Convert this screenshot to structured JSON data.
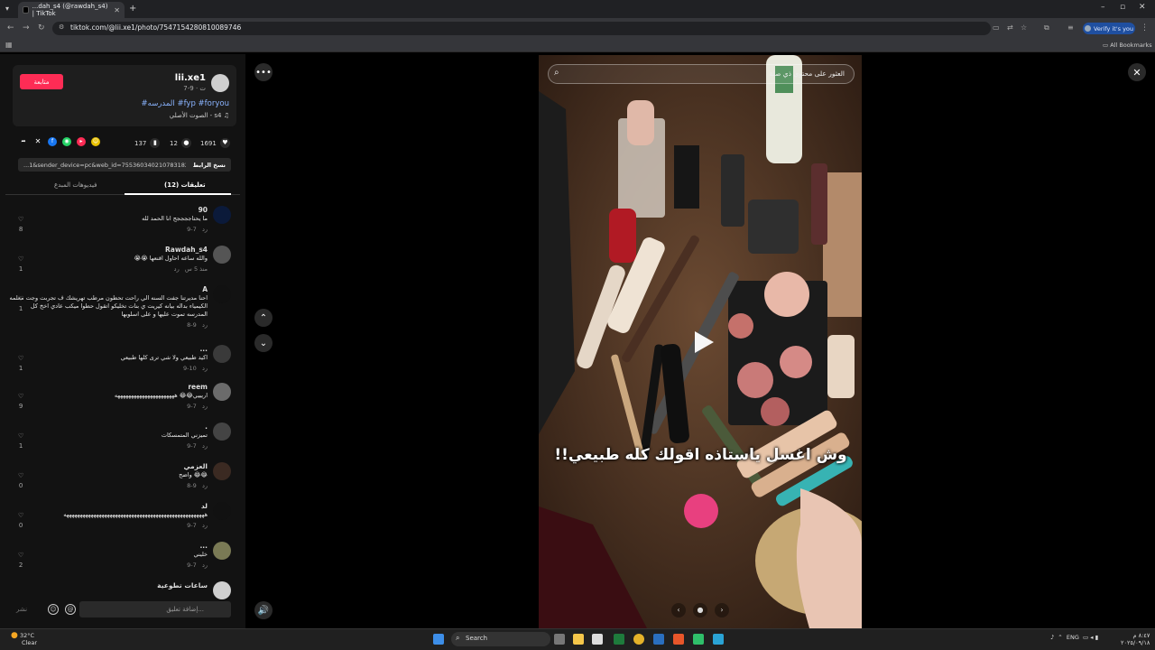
{
  "browser": {
    "tab_title": "...dah_s4 (@rawdah_s4) | TikTok",
    "url": "tiktok.com/@lii.xe1/photo/7547154280810089746",
    "verify_label": "Verify it's you",
    "bookmarks_label": "All Bookmarks"
  },
  "author": {
    "username": "lii.xe1",
    "date": "ت · 9-7",
    "follow_label": "متابعة",
    "hashtags": "#المدرسه #fyp #foryou",
    "sound": "الصوت الأصلي - s4"
  },
  "stats": {
    "likes": "1691",
    "comments": "12",
    "saves": "137"
  },
  "link": {
    "copy_label": "نسخ الرابط",
    "url_text": "...1&sender_device=pc&web_id=7553603402107831829"
  },
  "tabs": {
    "comments": "تعليقات (12)",
    "creator_videos": "فيديوهات المبدع"
  },
  "comments": [
    {
      "name": "90",
      "text": "ما يحتاججججج انا الحمد لله",
      "date": "9-7",
      "reply": "رد",
      "likes": "8",
      "avatar_color": "#0b1a3a"
    },
    {
      "name": "Rawdah_s4",
      "text": "والله ساعه احاول اقنعها 😭😭",
      "date": "منذ 5 س",
      "reply": "رد",
      "likes": "1",
      "avatar_color": "#555"
    },
    {
      "name": "A",
      "text": "احنا مديرتنا جفت السنه الي راحت تحطون مرطب تهريشك ف تجربت وجت معلمه الكيمياء بداله بيانه كيريت ي بنات تخليكو اتقول حطوا ميكب عادي اخخ كل المدرسه تموت عليها و على اسلوبها",
      "date": "8-9",
      "reply": "رد",
      "likes": "1",
      "avatar_color": "#111"
    },
    {
      "name": "...",
      "text": "اكيد طبيعي ولا شي ترى كلها طبيعي",
      "date": "9-10",
      "reply": "رد",
      "likes": "1",
      "avatar_color": "#3a3a3a"
    },
    {
      "name": "reem",
      "text": "اريييي😂😂 ههههههههههههههههههههههه",
      "date": "9-7",
      "reply": "رد",
      "likes": "9",
      "avatar_color": "#6b6b6b"
    },
    {
      "name": ".",
      "text": "تميزني المتمسكات",
      "date": "9-7",
      "reply": "رد",
      "likes": "1",
      "avatar_color": "#444"
    },
    {
      "name": "العزمي",
      "text": "😂😂 واضح",
      "date": "8-9",
      "reply": "رد",
      "likes": "0",
      "avatar_color": "#3b2a22"
    },
    {
      "name": "لد",
      "text": "ههههههههههههههههههههههههههههههههههههههههههههههههههههه",
      "date": "9-7",
      "reply": "رد",
      "likes": "0",
      "avatar_color": "#111"
    },
    {
      "name": "...",
      "text": "خليني",
      "date": "9-7",
      "reply": "رد",
      "likes": "2",
      "avatar_color": "#7a7a55"
    },
    {
      "name": "ساعات تطوعية",
      "text": "",
      "date": "",
      "reply": "",
      "likes": "",
      "avatar_color": "#cfcfcf"
    }
  ],
  "composer": {
    "placeholder": "إضافة تعليق...",
    "post_label": "نشر"
  },
  "viewer": {
    "search_placeholder": "العثور على محتوى ذي صلة",
    "caption": "وش اغسل ياستاذه اقولك كله طبيعي!!"
  },
  "taskbar": {
    "temp": "32°C",
    "condition": "Clear",
    "search_label": "Search",
    "lang": "ENG",
    "time": "٨:٤٧ م",
    "date": "٢٠٢٥/٠٩/١٨"
  }
}
